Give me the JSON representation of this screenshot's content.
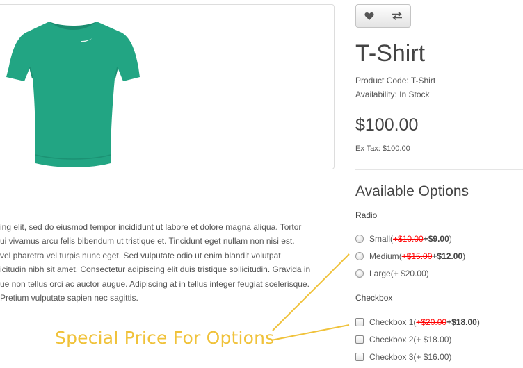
{
  "product": {
    "title": "T-Shirt",
    "code_label": "Product Code:",
    "code_value": "T-Shirt",
    "availability_label": "Availability:",
    "availability_value": "In Stock",
    "price": "$100.00",
    "ex_tax": "Ex Tax: $100.00"
  },
  "actions": {
    "wishlist_icon": "heart-icon",
    "compare_icon": "exchange-icon"
  },
  "description_lines": [
    "ing elit, sed do eiusmod tempor incididunt ut labore et dolore magna aliqua. Tortor",
    "ui vivamus arcu felis bibendum ut tristique et. Tincidunt eget nullam non nisi est.",
    "vel pharetra vel turpis nunc eget. Sed vulputate odio ut enim blandit volutpat",
    "icitudin nibh sit amet. Consectetur adipiscing elit duis tristique sollicitudin. Gravida in",
    "ue non tellus orci ac auctor augue. Adipiscing at in tellus integer feugiat scelerisque.",
    " Pretium vulputate sapien nec sagittis."
  ],
  "options": {
    "heading": "Available Options",
    "radio_label": "Radio",
    "radio_items": [
      {
        "name": "Small",
        "open": " (",
        "old": "+$10.00",
        "new": " +$9.00",
        "close": ")"
      },
      {
        "name": "Medium",
        "open": " (",
        "old": "+$15.00",
        "new": " +$12.00",
        "close": ")"
      },
      {
        "name": "Large",
        "plain": " (+ $20.00)"
      }
    ],
    "checkbox_label": "Checkbox",
    "checkbox_items": [
      {
        "name": "Checkbox 1",
        "open": " (",
        "old": "+$20.00",
        "new": " +$18.00",
        "close": ")"
      },
      {
        "name": "Checkbox 2",
        "plain": " (+ $18.00)"
      },
      {
        "name": "Checkbox 3",
        "plain": " (+ $16.00)"
      }
    ]
  },
  "annotation": {
    "text": "Special Price For Options",
    "color": "#f0c23a"
  },
  "colors": {
    "old_price": "#ff0000",
    "shirt": "#22a583"
  }
}
